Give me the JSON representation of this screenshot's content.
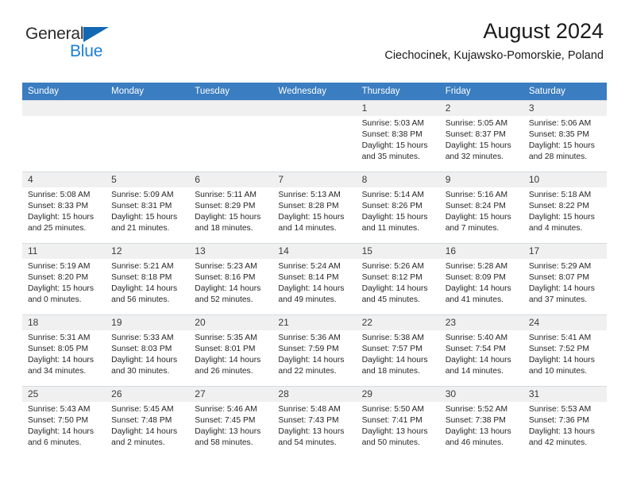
{
  "brand": {
    "name_part1": "General",
    "name_part2": "Blue",
    "triangle_color": "#1268b3",
    "blue_color": "#1a7fd4"
  },
  "header": {
    "title": "August 2024",
    "subtitle": "Ciechocinek, Kujawsko-Pomorskie, Poland"
  },
  "theme": {
    "header_row_bg": "#3a7dc0",
    "daynum_bg": "#f0f0f0",
    "grid_line": "#cfd6dc",
    "text": "#262626"
  },
  "weekdays": [
    "Sunday",
    "Monday",
    "Tuesday",
    "Wednesday",
    "Thursday",
    "Friday",
    "Saturday"
  ],
  "weeks": [
    [
      {
        "day": "",
        "sunrise": "",
        "sunset": "",
        "daylight1": "",
        "daylight2": "",
        "blank": true
      },
      {
        "day": "",
        "sunrise": "",
        "sunset": "",
        "daylight1": "",
        "daylight2": "",
        "blank": true
      },
      {
        "day": "",
        "sunrise": "",
        "sunset": "",
        "daylight1": "",
        "daylight2": "",
        "blank": true
      },
      {
        "day": "",
        "sunrise": "",
        "sunset": "",
        "daylight1": "",
        "daylight2": "",
        "blank": true
      },
      {
        "day": "1",
        "sunrise": "Sunrise: 5:03 AM",
        "sunset": "Sunset: 8:38 PM",
        "daylight1": "Daylight: 15 hours",
        "daylight2": "and 35 minutes."
      },
      {
        "day": "2",
        "sunrise": "Sunrise: 5:05 AM",
        "sunset": "Sunset: 8:37 PM",
        "daylight1": "Daylight: 15 hours",
        "daylight2": "and 32 minutes."
      },
      {
        "day": "3",
        "sunrise": "Sunrise: 5:06 AM",
        "sunset": "Sunset: 8:35 PM",
        "daylight1": "Daylight: 15 hours",
        "daylight2": "and 28 minutes."
      }
    ],
    [
      {
        "day": "4",
        "sunrise": "Sunrise: 5:08 AM",
        "sunset": "Sunset: 8:33 PM",
        "daylight1": "Daylight: 15 hours",
        "daylight2": "and 25 minutes."
      },
      {
        "day": "5",
        "sunrise": "Sunrise: 5:09 AM",
        "sunset": "Sunset: 8:31 PM",
        "daylight1": "Daylight: 15 hours",
        "daylight2": "and 21 minutes."
      },
      {
        "day": "6",
        "sunrise": "Sunrise: 5:11 AM",
        "sunset": "Sunset: 8:29 PM",
        "daylight1": "Daylight: 15 hours",
        "daylight2": "and 18 minutes."
      },
      {
        "day": "7",
        "sunrise": "Sunrise: 5:13 AM",
        "sunset": "Sunset: 8:28 PM",
        "daylight1": "Daylight: 15 hours",
        "daylight2": "and 14 minutes."
      },
      {
        "day": "8",
        "sunrise": "Sunrise: 5:14 AM",
        "sunset": "Sunset: 8:26 PM",
        "daylight1": "Daylight: 15 hours",
        "daylight2": "and 11 minutes."
      },
      {
        "day": "9",
        "sunrise": "Sunrise: 5:16 AM",
        "sunset": "Sunset: 8:24 PM",
        "daylight1": "Daylight: 15 hours",
        "daylight2": "and 7 minutes."
      },
      {
        "day": "10",
        "sunrise": "Sunrise: 5:18 AM",
        "sunset": "Sunset: 8:22 PM",
        "daylight1": "Daylight: 15 hours",
        "daylight2": "and 4 minutes."
      }
    ],
    [
      {
        "day": "11",
        "sunrise": "Sunrise: 5:19 AM",
        "sunset": "Sunset: 8:20 PM",
        "daylight1": "Daylight: 15 hours",
        "daylight2": "and 0 minutes."
      },
      {
        "day": "12",
        "sunrise": "Sunrise: 5:21 AM",
        "sunset": "Sunset: 8:18 PM",
        "daylight1": "Daylight: 14 hours",
        "daylight2": "and 56 minutes."
      },
      {
        "day": "13",
        "sunrise": "Sunrise: 5:23 AM",
        "sunset": "Sunset: 8:16 PM",
        "daylight1": "Daylight: 14 hours",
        "daylight2": "and 52 minutes."
      },
      {
        "day": "14",
        "sunrise": "Sunrise: 5:24 AM",
        "sunset": "Sunset: 8:14 PM",
        "daylight1": "Daylight: 14 hours",
        "daylight2": "and 49 minutes."
      },
      {
        "day": "15",
        "sunrise": "Sunrise: 5:26 AM",
        "sunset": "Sunset: 8:12 PM",
        "daylight1": "Daylight: 14 hours",
        "daylight2": "and 45 minutes."
      },
      {
        "day": "16",
        "sunrise": "Sunrise: 5:28 AM",
        "sunset": "Sunset: 8:09 PM",
        "daylight1": "Daylight: 14 hours",
        "daylight2": "and 41 minutes."
      },
      {
        "day": "17",
        "sunrise": "Sunrise: 5:29 AM",
        "sunset": "Sunset: 8:07 PM",
        "daylight1": "Daylight: 14 hours",
        "daylight2": "and 37 minutes."
      }
    ],
    [
      {
        "day": "18",
        "sunrise": "Sunrise: 5:31 AM",
        "sunset": "Sunset: 8:05 PM",
        "daylight1": "Daylight: 14 hours",
        "daylight2": "and 34 minutes."
      },
      {
        "day": "19",
        "sunrise": "Sunrise: 5:33 AM",
        "sunset": "Sunset: 8:03 PM",
        "daylight1": "Daylight: 14 hours",
        "daylight2": "and 30 minutes."
      },
      {
        "day": "20",
        "sunrise": "Sunrise: 5:35 AM",
        "sunset": "Sunset: 8:01 PM",
        "daylight1": "Daylight: 14 hours",
        "daylight2": "and 26 minutes."
      },
      {
        "day": "21",
        "sunrise": "Sunrise: 5:36 AM",
        "sunset": "Sunset: 7:59 PM",
        "daylight1": "Daylight: 14 hours",
        "daylight2": "and 22 minutes."
      },
      {
        "day": "22",
        "sunrise": "Sunrise: 5:38 AM",
        "sunset": "Sunset: 7:57 PM",
        "daylight1": "Daylight: 14 hours",
        "daylight2": "and 18 minutes."
      },
      {
        "day": "23",
        "sunrise": "Sunrise: 5:40 AM",
        "sunset": "Sunset: 7:54 PM",
        "daylight1": "Daylight: 14 hours",
        "daylight2": "and 14 minutes."
      },
      {
        "day": "24",
        "sunrise": "Sunrise: 5:41 AM",
        "sunset": "Sunset: 7:52 PM",
        "daylight1": "Daylight: 14 hours",
        "daylight2": "and 10 minutes."
      }
    ],
    [
      {
        "day": "25",
        "sunrise": "Sunrise: 5:43 AM",
        "sunset": "Sunset: 7:50 PM",
        "daylight1": "Daylight: 14 hours",
        "daylight2": "and 6 minutes."
      },
      {
        "day": "26",
        "sunrise": "Sunrise: 5:45 AM",
        "sunset": "Sunset: 7:48 PM",
        "daylight1": "Daylight: 14 hours",
        "daylight2": "and 2 minutes."
      },
      {
        "day": "27",
        "sunrise": "Sunrise: 5:46 AM",
        "sunset": "Sunset: 7:45 PM",
        "daylight1": "Daylight: 13 hours",
        "daylight2": "and 58 minutes."
      },
      {
        "day": "28",
        "sunrise": "Sunrise: 5:48 AM",
        "sunset": "Sunset: 7:43 PM",
        "daylight1": "Daylight: 13 hours",
        "daylight2": "and 54 minutes."
      },
      {
        "day": "29",
        "sunrise": "Sunrise: 5:50 AM",
        "sunset": "Sunset: 7:41 PM",
        "daylight1": "Daylight: 13 hours",
        "daylight2": "and 50 minutes."
      },
      {
        "day": "30",
        "sunrise": "Sunrise: 5:52 AM",
        "sunset": "Sunset: 7:38 PM",
        "daylight1": "Daylight: 13 hours",
        "daylight2": "and 46 minutes."
      },
      {
        "day": "31",
        "sunrise": "Sunrise: 5:53 AM",
        "sunset": "Sunset: 7:36 PM",
        "daylight1": "Daylight: 13 hours",
        "daylight2": "and 42 minutes."
      }
    ]
  ]
}
